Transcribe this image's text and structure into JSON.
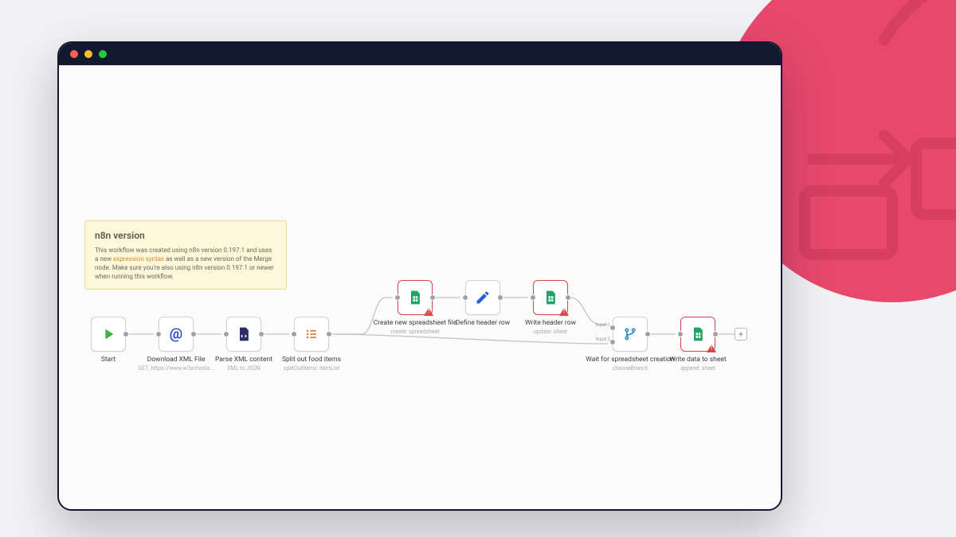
{
  "decorative_circle_color": "#e8486d",
  "sticky": {
    "title": "n8n version",
    "body_before_link": "This workflow was created using n8n version 0.197.1 and uses a new ",
    "link_text": "expression syntax",
    "body_after_link": " as well as a new version of the Merge node. Make sure you're also using n8n version 0.197.1 or newer when running this workflow."
  },
  "nodes": {
    "start": {
      "title": "Start",
      "sub": ""
    },
    "dl": {
      "title": "Download XML File",
      "sub": "GET: https://www.w3schools..."
    },
    "parse": {
      "title": "Parse XML content",
      "sub": "XML to JSON"
    },
    "split": {
      "title": "Split out food items",
      "sub": "splitOutItems: itemList"
    },
    "create": {
      "title": "Create new spreadsheet file",
      "sub": "create: spreadsheet"
    },
    "header": {
      "title": "Define header row",
      "sub": ""
    },
    "write": {
      "title": "Write header row",
      "sub": "update: sheet"
    },
    "merge": {
      "title": "Wait for spreadsheet creation",
      "sub": "chooseBranch",
      "port1": "Input 1",
      "port2": "Input 2"
    },
    "final": {
      "title": "Write data to sheet",
      "sub": "append: sheet"
    }
  },
  "add_button": "+"
}
